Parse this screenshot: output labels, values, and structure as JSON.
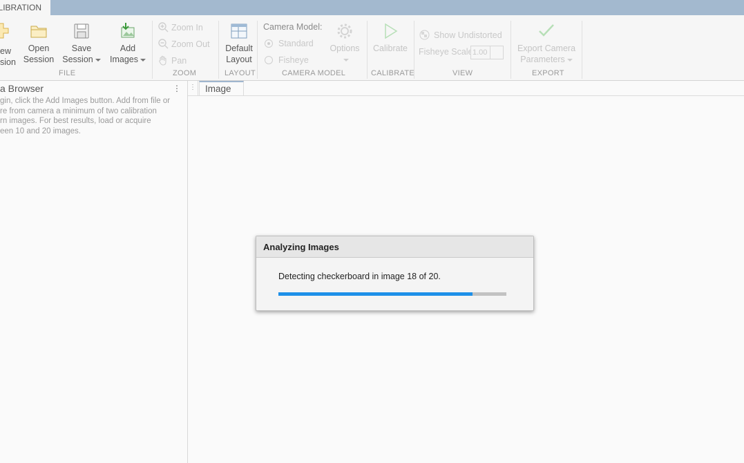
{
  "app": {
    "tab_label": "ALIBRATION"
  },
  "toolstrip": {
    "file": {
      "label": "FILE",
      "new_session_l1": "ew",
      "new_session_l2": "sion",
      "open_session_l1": "Open",
      "open_session_l2": "Session",
      "save_session_l1": "Save",
      "save_session_l2": "Session",
      "add_images_l1": "Add",
      "add_images_l2": "Images"
    },
    "zoom": {
      "label": "ZOOM",
      "zoom_in": "Zoom In",
      "zoom_out": "Zoom Out",
      "pan": "Pan"
    },
    "layout": {
      "label": "LAYOUT",
      "default_l1": "Default",
      "default_l2": "Layout"
    },
    "camera_model": {
      "label": "CAMERA MODEL",
      "title": "Camera Model:",
      "standard": "Standard",
      "fisheye": "Fisheye",
      "options": "Options"
    },
    "calibrate": {
      "label": "CALIBRATE",
      "button": "Calibrate"
    },
    "view": {
      "label": "VIEW",
      "show_undistorted": "Show Undistorted",
      "fisheye_scale": "Fisheye Scale",
      "fisheye_scale_value": "1.00"
    },
    "export": {
      "label": "EXPORT",
      "l1": "Export Camera",
      "l2": "Parameters"
    }
  },
  "browser": {
    "title": "a Browser",
    "lines": [
      "gin, click the Add Images button. Add from file or",
      "re from camera a minimum of two calibration",
      "rn images. For best results, load or acquire",
      "een 10 and 20 images."
    ]
  },
  "document": {
    "tab_label": "Image"
  },
  "dialog": {
    "title": "Analyzing Images",
    "message": "Detecting checkerboard in image 18 of 20.",
    "progress": 0.85
  },
  "colors": {
    "progress": "#1e90e8",
    "tab_bar": "#a3b9cf"
  }
}
